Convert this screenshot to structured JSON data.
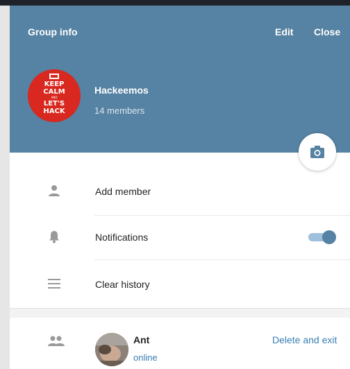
{
  "header": {
    "title": "Group info",
    "edit_label": "Edit",
    "close_label": "Close",
    "background_color": "#5682a3"
  },
  "group": {
    "name": "Hackeemos",
    "members_count": "14 members",
    "avatar_text": [
      "KEEP",
      "CALM",
      "AND",
      "LET'S",
      "HACK"
    ]
  },
  "actions": {
    "add_member": "Add member",
    "notifications": "Notifications",
    "notifications_enabled": true,
    "clear_history": "Clear history"
  },
  "members": {
    "delete_and_exit": "Delete and exit",
    "list": [
      {
        "name": "Ant",
        "status": "online"
      }
    ]
  },
  "icons": {
    "camera": "camera-icon",
    "add_member": "person-icon",
    "notifications": "bell-icon",
    "clear_history": "menu-lines-icon",
    "members": "people-icon"
  }
}
